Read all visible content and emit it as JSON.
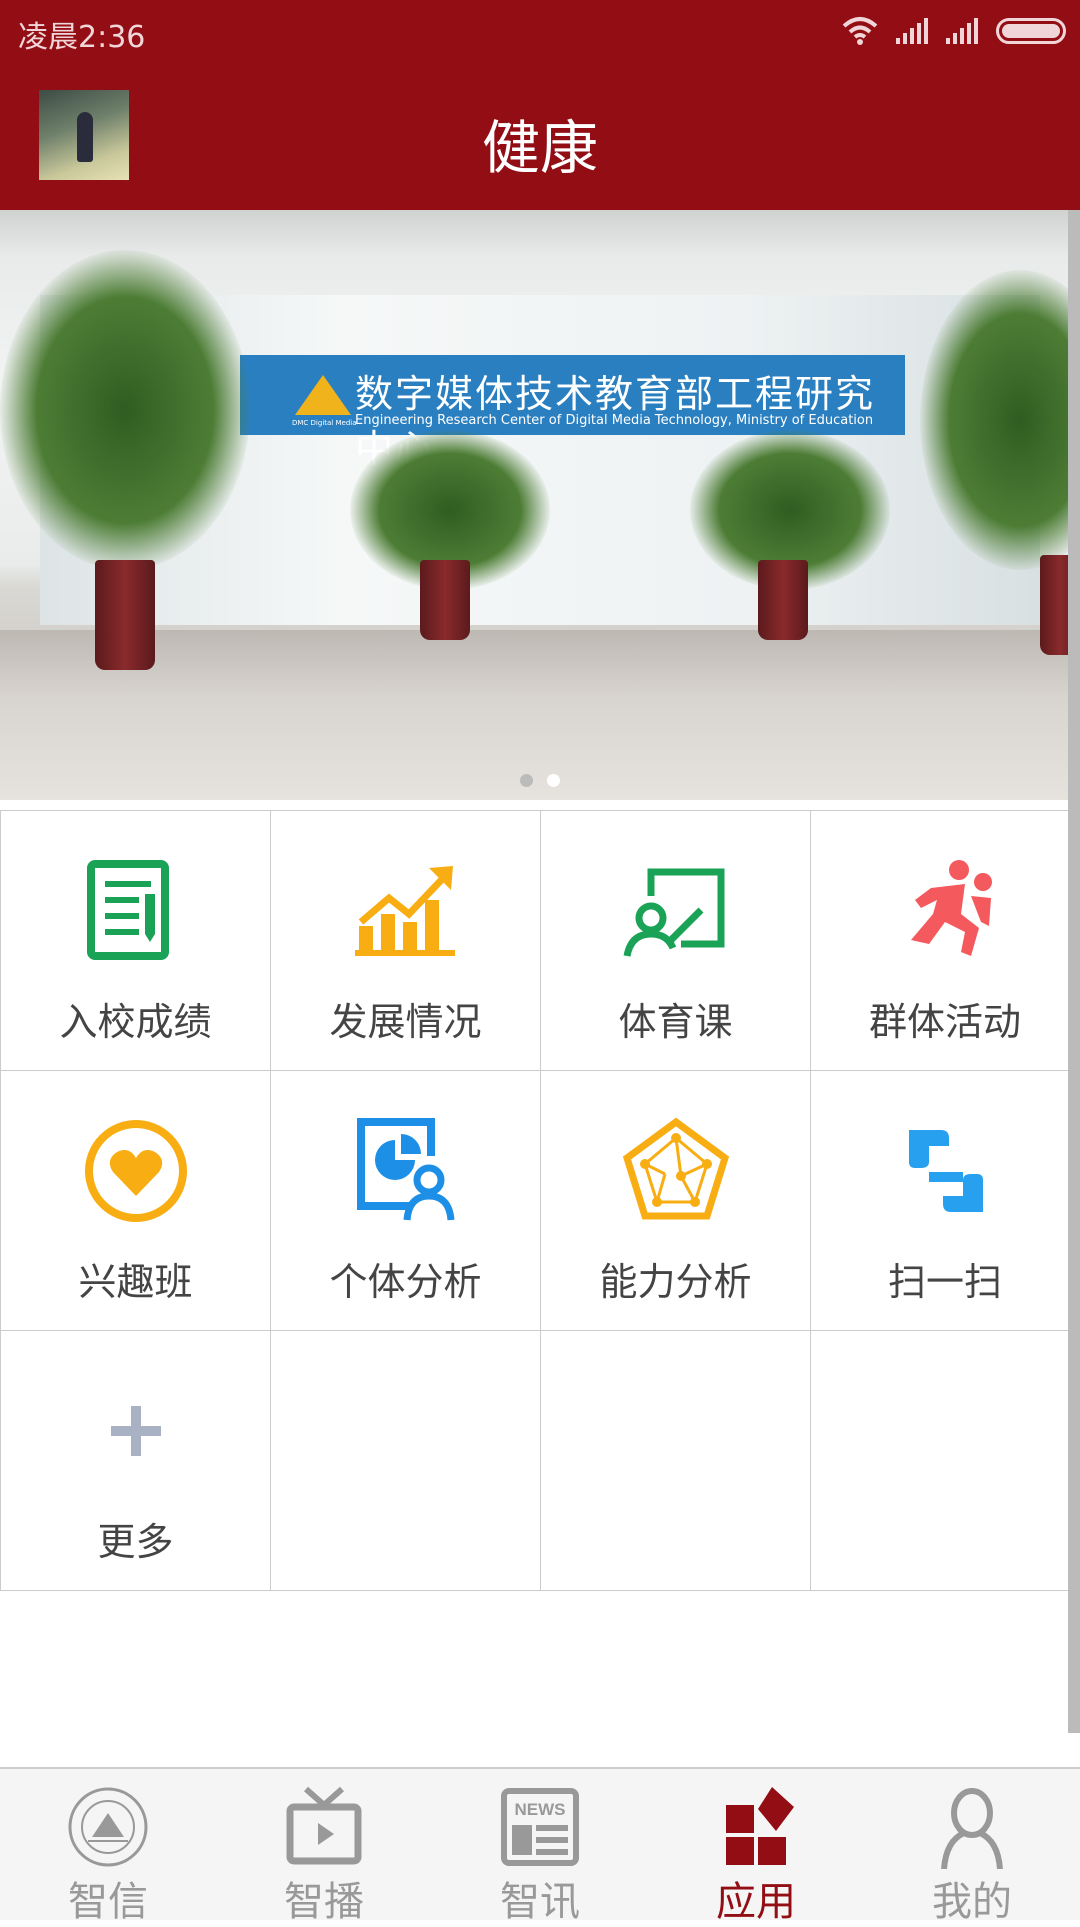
{
  "status_bar": {
    "time": "凌晨2:36",
    "icons": [
      "wifi-icon",
      "signal-icon",
      "signal-icon",
      "battery-icon"
    ]
  },
  "header": {
    "title": "健康",
    "avatar": "user-avatar"
  },
  "banner": {
    "sign_cn": "数字媒体技术教育部工程研究中心",
    "sign_en": "Engineering Research Center of Digital Media Technology, Ministry of Education",
    "logo_text": "DMC Digital Media",
    "pages": 2,
    "active_page": 2
  },
  "grid": {
    "items": [
      {
        "label": "入校成绩",
        "icon": "report-icon",
        "color": "#1aa356"
      },
      {
        "label": "发展情况",
        "icon": "growth-chart-icon",
        "color": "#f8ad12"
      },
      {
        "label": "体育课",
        "icon": "pe-class-icon",
        "color": "#1aa356"
      },
      {
        "label": "群体活动",
        "icon": "running-people-icon",
        "color": "#f4595e"
      },
      {
        "label": "兴趣班",
        "icon": "heart-icon",
        "color": "#f8ad12"
      },
      {
        "label": "个体分析",
        "icon": "personal-analysis-icon",
        "color": "#1e8fe6"
      },
      {
        "label": "能力分析",
        "icon": "radar-icon",
        "color": "#f8ad12"
      },
      {
        "label": "扫一扫",
        "icon": "scan-icon",
        "color": "#27a0f0"
      },
      {
        "label": "更多",
        "icon": "plus-icon",
        "color": "#a9b1c4"
      }
    ]
  },
  "nav": {
    "accent": "#920d14",
    "items": [
      {
        "label": "智信",
        "icon": "university-seal-icon"
      },
      {
        "label": "智播",
        "icon": "tv-play-icon"
      },
      {
        "label": "智讯",
        "icon": "news-icon",
        "icon_text": "NEWS"
      },
      {
        "label": "应用",
        "icon": "apps-icon",
        "active": true
      },
      {
        "label": "我的",
        "icon": "person-icon"
      }
    ]
  }
}
